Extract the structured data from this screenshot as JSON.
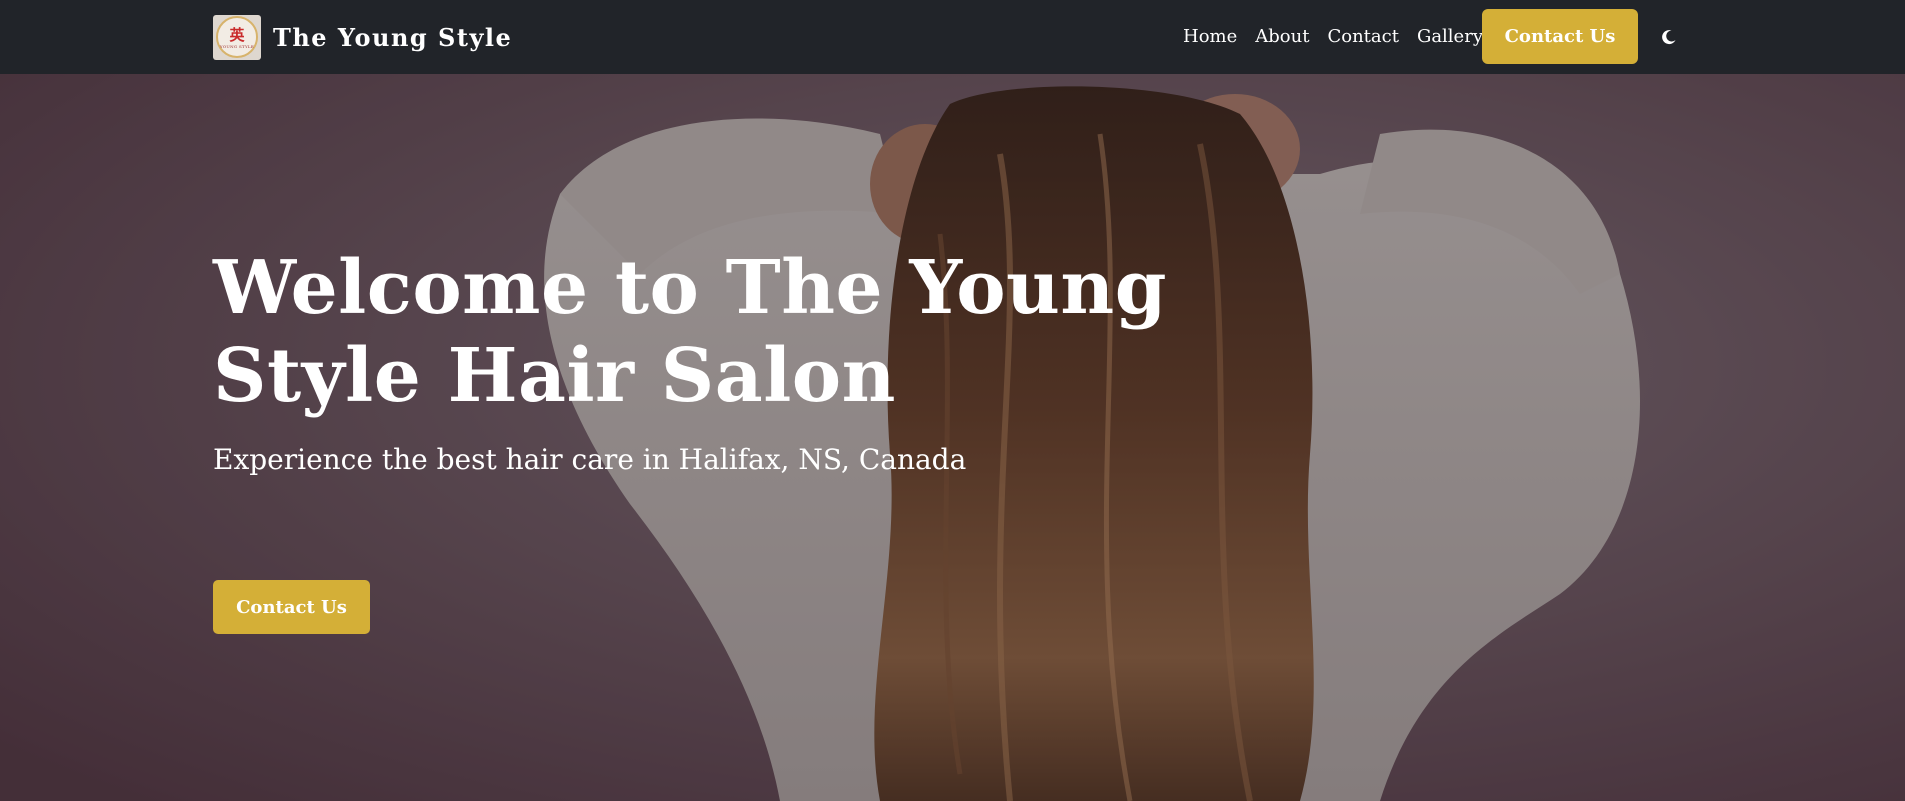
{
  "brand": {
    "name": "The Young Style",
    "logo_char": "英",
    "logo_sub": "YOUNG STYLE"
  },
  "nav": {
    "links": [
      {
        "label": "Home"
      },
      {
        "label": "About"
      },
      {
        "label": "Contact"
      },
      {
        "label": "Gallery"
      }
    ],
    "cta_label": "Contact Us",
    "theme_icon": "moon-icon"
  },
  "hero": {
    "title": "Welcome to The Young Style Hair Salon",
    "subtitle": "Experience the best hair care in Halifax, NS, Canada",
    "cta_label": "Contact Us"
  },
  "colors": {
    "navbar_bg": "#212429",
    "accent_gold": "#d4af37",
    "text_light": "#ffffff"
  }
}
